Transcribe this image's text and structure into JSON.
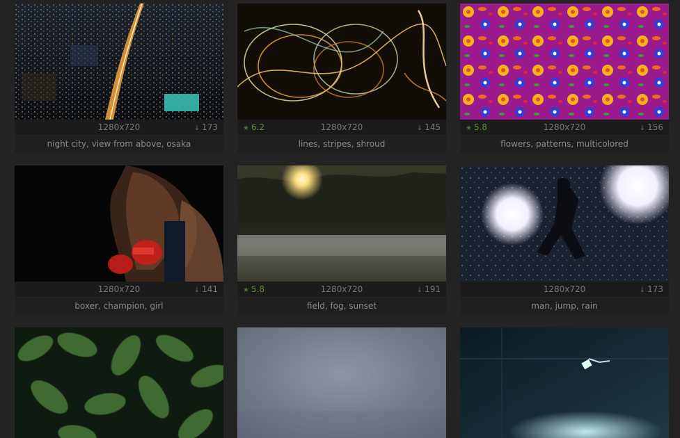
{
  "wallpapers": [
    {
      "resolution": "1280x720",
      "rating": "",
      "downloads": "173",
      "tags": "night city, view from above, osaka",
      "image": "night-city-thumbnail"
    },
    {
      "resolution": "1280x720",
      "rating": "6.2",
      "downloads": "145",
      "tags": "lines, stripes, shroud",
      "image": "light-lines-thumbnail"
    },
    {
      "resolution": "1280x720",
      "rating": "5.8",
      "downloads": "156",
      "tags": "flowers, patterns, multicolored",
      "image": "flower-pattern-thumbnail"
    },
    {
      "resolution": "1280x720",
      "rating": "",
      "downloads": "141",
      "tags": "boxer, champion, girl",
      "image": "boxer-girl-thumbnail"
    },
    {
      "resolution": "1280x720",
      "rating": "5.8",
      "downloads": "191",
      "tags": "field, fog, sunset",
      "image": "foggy-field-thumbnail"
    },
    {
      "resolution": "1280x720",
      "rating": "",
      "downloads": "173",
      "tags": "man, jump, rain",
      "image": "man-jump-rain-thumbnail"
    },
    {
      "resolution": "",
      "rating": "",
      "downloads": "",
      "tags": "",
      "image": "leaves-thumbnail"
    },
    {
      "resolution": "",
      "rating": "",
      "downloads": "",
      "tags": "",
      "image": "gray-texture-thumbnail"
    },
    {
      "resolution": "",
      "rating": "",
      "downloads": "",
      "tags": "",
      "image": "lamp-wall-thumbnail"
    }
  ],
  "colors": {
    "background": "#232323",
    "rating": "#5e8f3e",
    "text": "#777777"
  }
}
